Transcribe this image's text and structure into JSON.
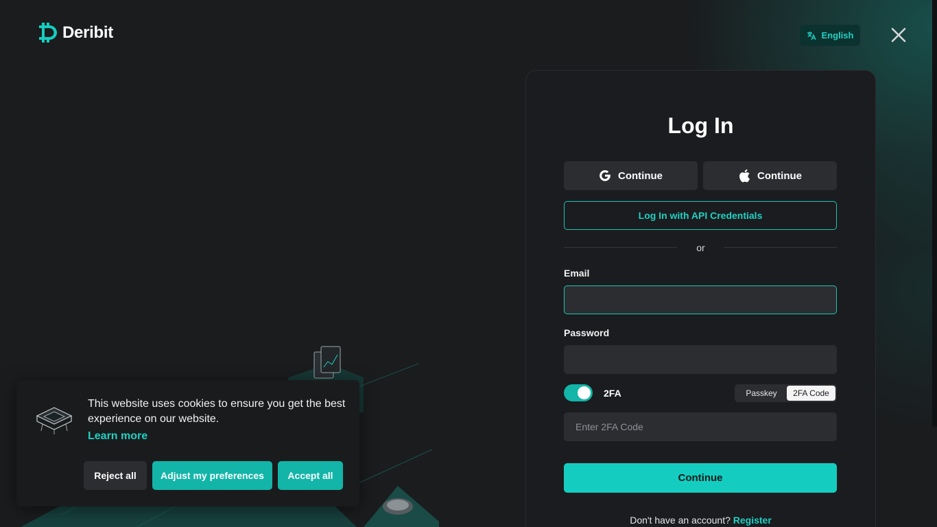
{
  "brand": {
    "name": "Deribit",
    "accent": "#14cdc0"
  },
  "header": {
    "language_label": "English",
    "language_icon": "translate-icon",
    "close_icon": "close-icon"
  },
  "login": {
    "title": "Log In",
    "google_label": "Continue",
    "google_icon": "google-icon",
    "apple_label": "Continue",
    "apple_icon": "apple-icon",
    "api_label": "Log In with API Credentials",
    "or_label": "or",
    "email_label": "Email",
    "email_value": "",
    "password_label": "Password",
    "password_value": "",
    "twofa_toggle_label": "2FA",
    "twofa_enabled": true,
    "method_options": [
      "Passkey",
      "2FA Code"
    ],
    "method_selected": "2FA Code",
    "twofa_placeholder": "Enter 2FA Code",
    "submit_label": "Continue",
    "register_prompt": "Don't have an account?",
    "register_link": "Register"
  },
  "cookie_banner": {
    "message": "This website uses cookies to ensure you get the best experience on our website.",
    "learn_more": "Learn more",
    "reject_label": "Reject all",
    "adjust_label": "Adjust my preferences",
    "accept_label": "Accept all"
  }
}
